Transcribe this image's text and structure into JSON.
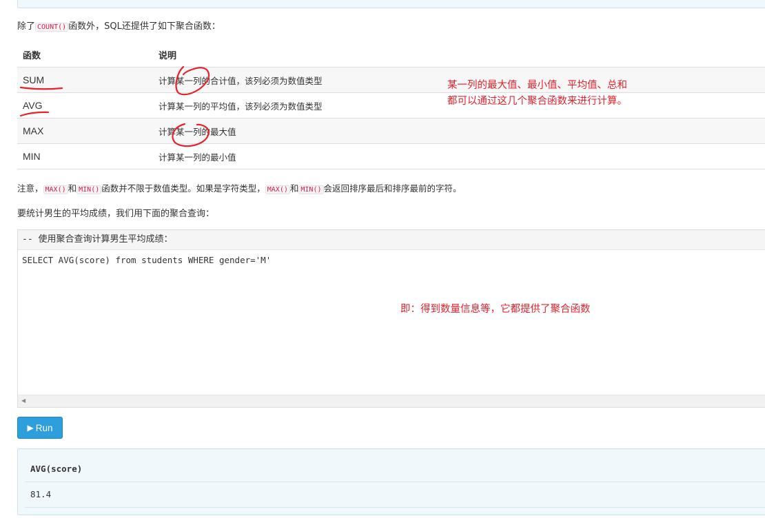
{
  "intro": {
    "before": "除了",
    "code": "COUNT()",
    "after": "函数外，SQL还提供了如下聚合函数："
  },
  "table": {
    "headers": [
      "函数",
      "说明"
    ],
    "rows": [
      {
        "fn": "SUM",
        "desc": "计算某一列的合计值，该列必须为数值类型"
      },
      {
        "fn": "AVG",
        "desc": "计算某一列的平均值，该列必须为数值类型"
      },
      {
        "fn": "MAX",
        "desc": "计算某一列的最大值"
      },
      {
        "fn": "MIN",
        "desc": "计算某一列的最小值"
      }
    ]
  },
  "annotation1": {
    "line1": "某一列的最大值、最小值、平均值、总和",
    "line2": "都可以通过这几个聚合函数来进行计算。"
  },
  "note": {
    "p1": "注意，",
    "c1": "MAX()",
    "p2": "和",
    "c2": "MIN()",
    "p3": "函数并不限于数值类型。如果是字符类型，",
    "c3": "MAX()",
    "p4": "和",
    "c4": "MIN()",
    "p5": "会返回排序最后和排序最前的字符。"
  },
  "query_intro": "要统计男生的平均成绩，我们用下面的聚合查询：",
  "editor": {
    "comment": "-- 使用聚合查询计算男生平均成绩：",
    "code": "SELECT AVG(score) from students WHERE gender='M'"
  },
  "annotation2": "即：得到数量信息等，它都提供了聚合函数",
  "run_button": {
    "label": "Run",
    "icon": "play-icon"
  },
  "result": {
    "column": "AVG(score)",
    "value": "81.4"
  },
  "colors": {
    "annotation": "#e8212b",
    "run_button": "#2d9fdc",
    "result_bg": "#f1f8fc"
  }
}
